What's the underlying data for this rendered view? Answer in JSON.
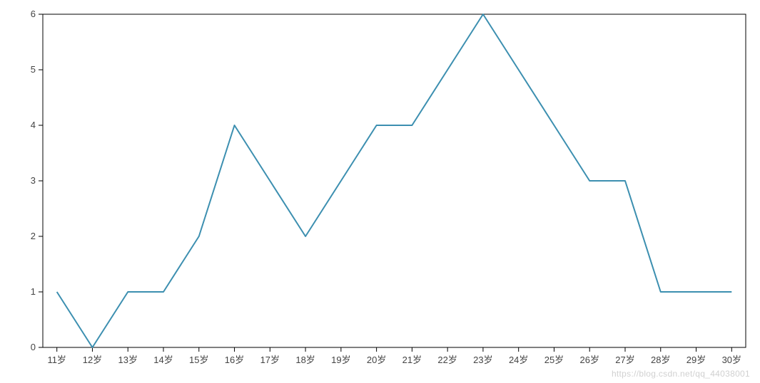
{
  "chart_data": {
    "type": "line",
    "categories": [
      "11岁",
      "12岁",
      "13岁",
      "14岁",
      "15岁",
      "16岁",
      "17岁",
      "18岁",
      "19岁",
      "20岁",
      "21岁",
      "22岁",
      "23岁",
      "24岁",
      "25岁",
      "26岁",
      "27岁",
      "28岁",
      "29岁",
      "30岁"
    ],
    "values": [
      1,
      0,
      1,
      1,
      2,
      4,
      3,
      2,
      3,
      4,
      4,
      5,
      6,
      5,
      4,
      3,
      3,
      1,
      1,
      1
    ],
    "title": "",
    "xlabel": "",
    "ylabel": "",
    "ylim": [
      0,
      6
    ],
    "yticks": [
      0,
      1,
      2,
      3,
      4,
      5,
      6
    ],
    "line_color": "#3c8fb0",
    "border_color": "#000000",
    "tick_color": "#000000"
  },
  "watermark": "https://blog.csdn.net/qq_44038001"
}
